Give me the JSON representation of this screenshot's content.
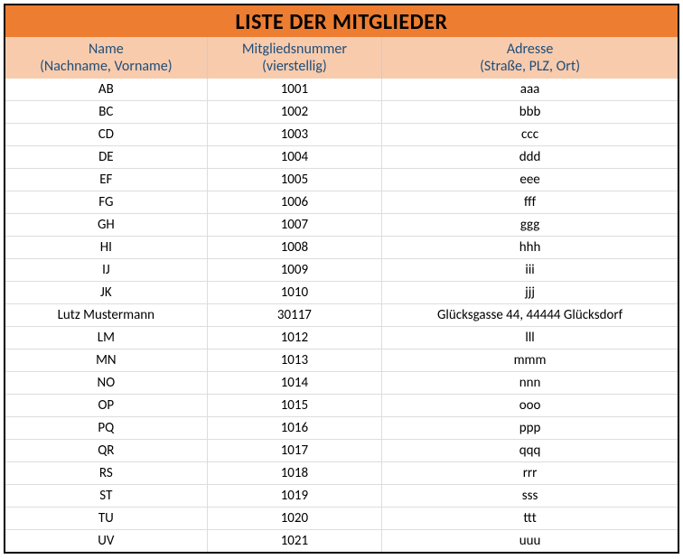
{
  "title": "LISTE DER MITGLIEDER",
  "columns": [
    {
      "line1": "Name",
      "line2": "(Nachname, Vorname)"
    },
    {
      "line1": "Mitgliedsnummer",
      "line2": "(vierstellig)"
    },
    {
      "line1": "Adresse",
      "line2": "(Straße, PLZ, Ort)"
    }
  ],
  "rows": [
    {
      "name": "AB",
      "number": "1001",
      "address": "aaa"
    },
    {
      "name": "BC",
      "number": "1002",
      "address": "bbb"
    },
    {
      "name": "CD",
      "number": "1003",
      "address": "ccc"
    },
    {
      "name": "DE",
      "number": "1004",
      "address": "ddd"
    },
    {
      "name": "EF",
      "number": "1005",
      "address": "eee"
    },
    {
      "name": "FG",
      "number": "1006",
      "address": "fff"
    },
    {
      "name": "GH",
      "number": "1007",
      "address": "ggg"
    },
    {
      "name": "HI",
      "number": "1008",
      "address": "hhh"
    },
    {
      "name": "IJ",
      "number": "1009",
      "address": "iii"
    },
    {
      "name": "JK",
      "number": "1010",
      "address": "jjj"
    },
    {
      "name": "Lutz Mustermann",
      "number": "30117",
      "address": "Glücksgasse 44, 44444 Glücksdorf"
    },
    {
      "name": "LM",
      "number": "1012",
      "address": "lll"
    },
    {
      "name": "MN",
      "number": "1013",
      "address": "mmm"
    },
    {
      "name": "NO",
      "number": "1014",
      "address": "nnn"
    },
    {
      "name": "OP",
      "number": "1015",
      "address": "ooo"
    },
    {
      "name": "PQ",
      "number": "1016",
      "address": "ppp"
    },
    {
      "name": "QR",
      "number": "1017",
      "address": "qqq"
    },
    {
      "name": "RS",
      "number": "1018",
      "address": "rrr"
    },
    {
      "name": "ST",
      "number": "1019",
      "address": "sss"
    },
    {
      "name": "TU",
      "number": "1020",
      "address": "ttt"
    },
    {
      "name": "UV",
      "number": "1021",
      "address": "uuu"
    }
  ]
}
